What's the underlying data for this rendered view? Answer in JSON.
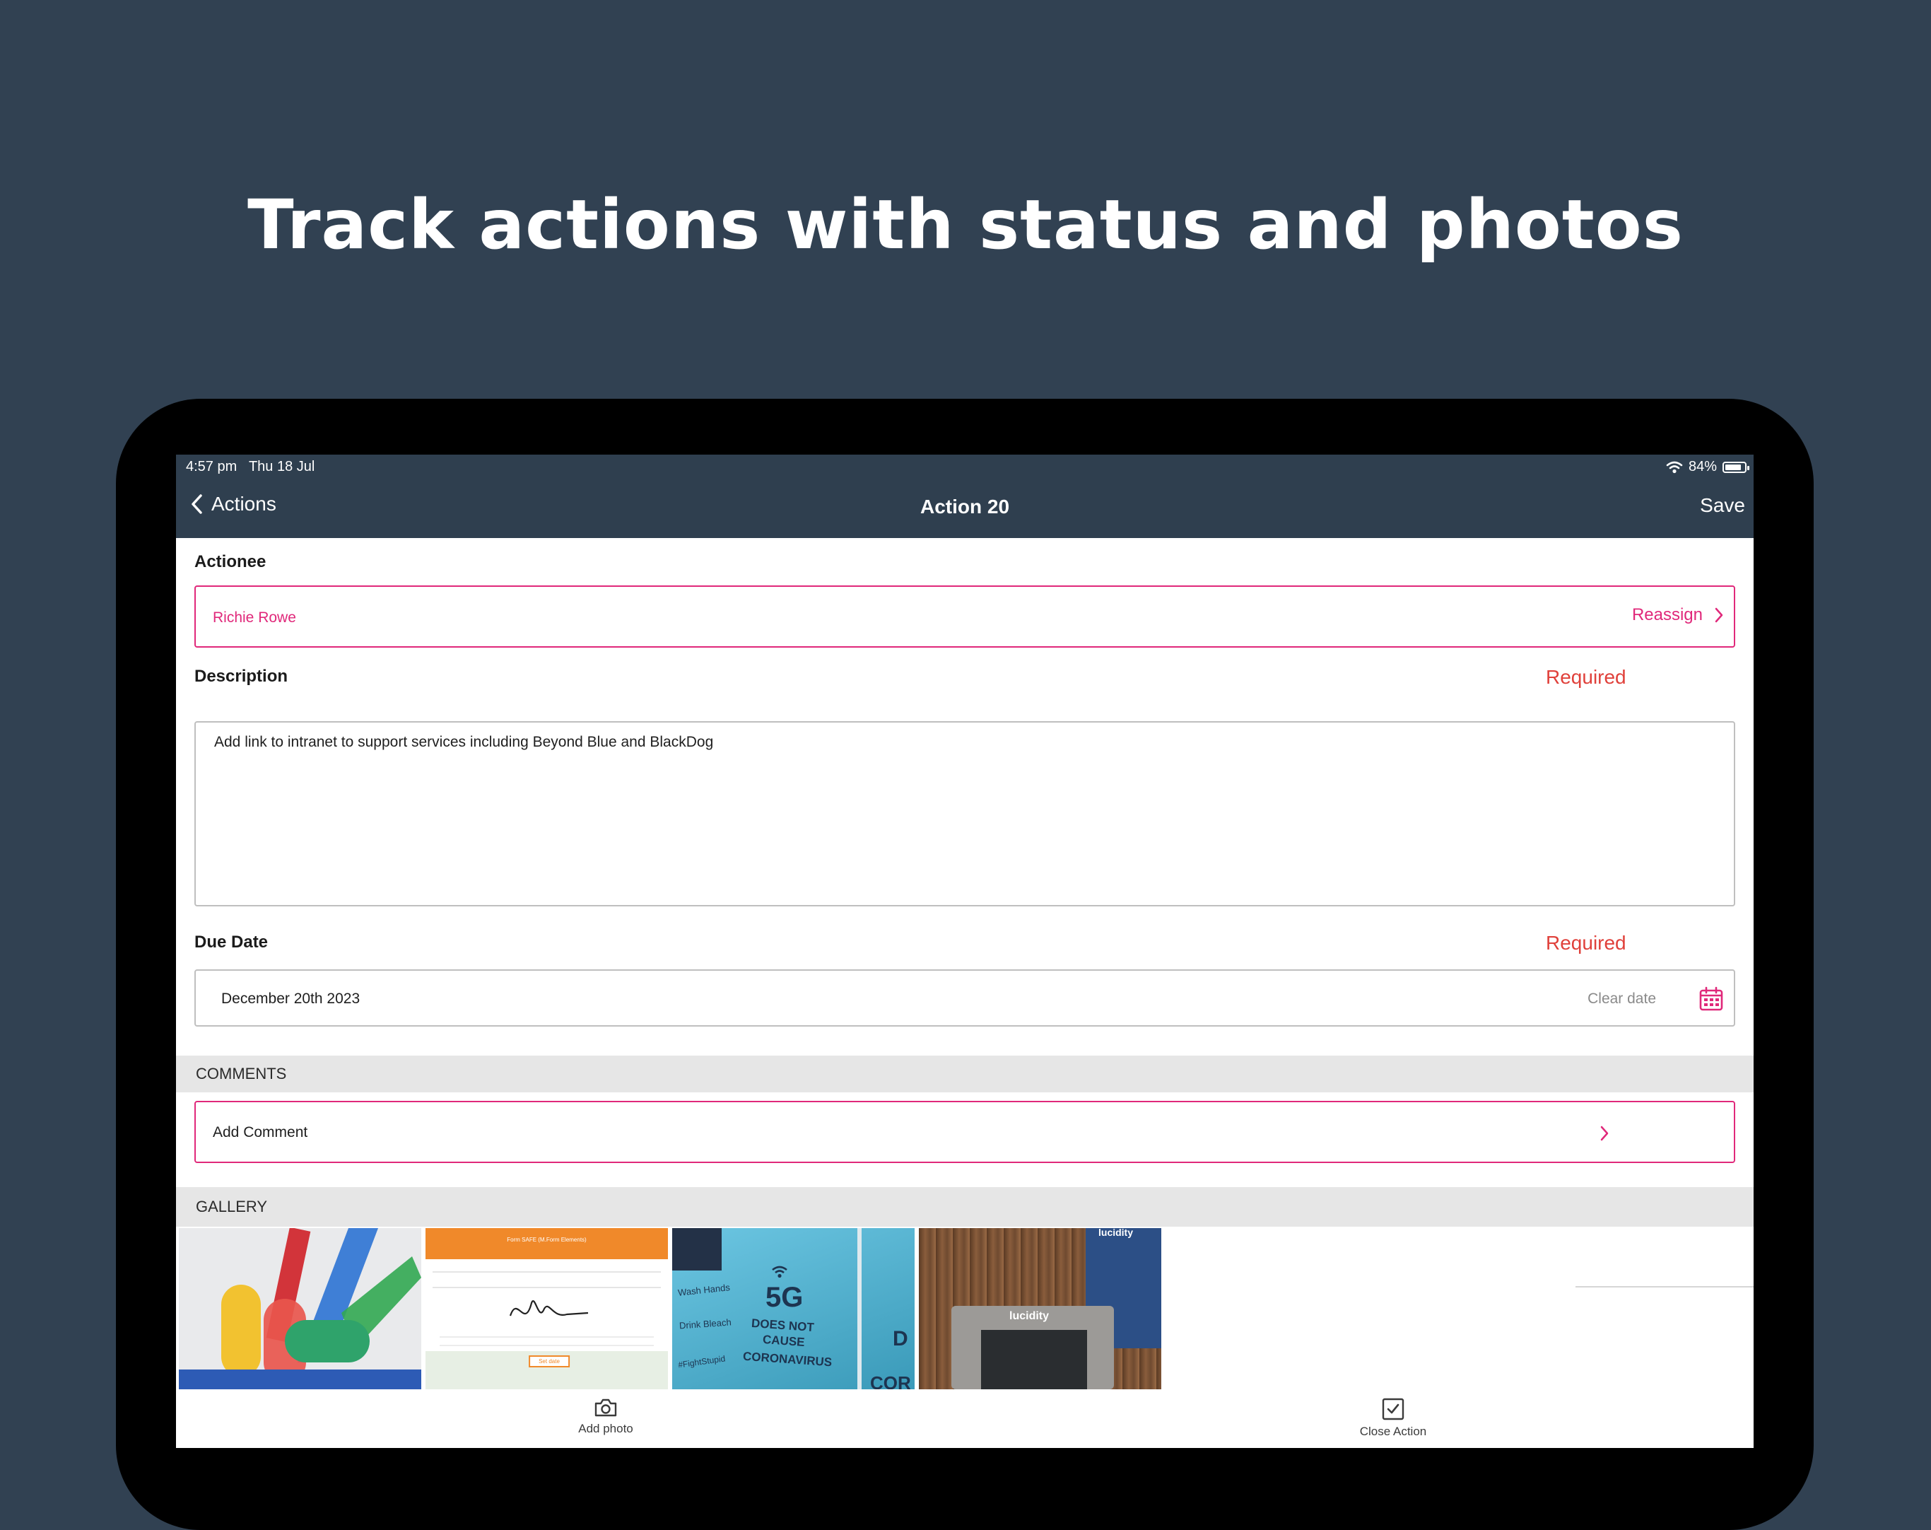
{
  "marketing": {
    "title": "Track actions with status and photos"
  },
  "status_bar": {
    "time": "4:57 pm",
    "date": "Thu 18 Jul",
    "battery": "84%",
    "battery_level": 0.84
  },
  "nav": {
    "back_label": "Actions",
    "title": "Action 20",
    "save_label": "Save"
  },
  "actionee": {
    "label": "Actionee",
    "value": "Richie Rowe",
    "reassign_label": "Reassign"
  },
  "description": {
    "label": "Description",
    "required": "Required",
    "value": "Add link to intranet to support services including Beyond Blue and BlackDog"
  },
  "due_date": {
    "label": "Due Date",
    "required": "Required",
    "value": "December 20th 2023",
    "clear_label": "Clear date"
  },
  "comments": {
    "header": "COMMENTS",
    "add_label": "Add Comment"
  },
  "gallery": {
    "header": "GALLERY",
    "photos": [
      {
        "name": "colorful-logo-photo"
      },
      {
        "name": "signature-form-photo",
        "banner_text": "Form SAFE (M.Form Elements)",
        "button_text": "Set date"
      },
      {
        "name": "5g-poster-photo",
        "texts": [
          "Wash Hands",
          "Drink Bleach",
          "5G",
          "DOES NOT",
          "CAUSE",
          "CORONAVIRUS",
          "#FightStupid",
          "D",
          "COR"
        ]
      },
      {
        "name": "lucidity-device-photo",
        "texts": [
          "lucidity",
          "lucidity"
        ]
      }
    ]
  },
  "toolbar": {
    "add_photo_label": "Add photo",
    "close_action_label": "Close Action"
  },
  "colors": {
    "brand_dark": "#2f3f4f",
    "accent_pink": "#e0287a",
    "required_red": "#e0413b"
  }
}
